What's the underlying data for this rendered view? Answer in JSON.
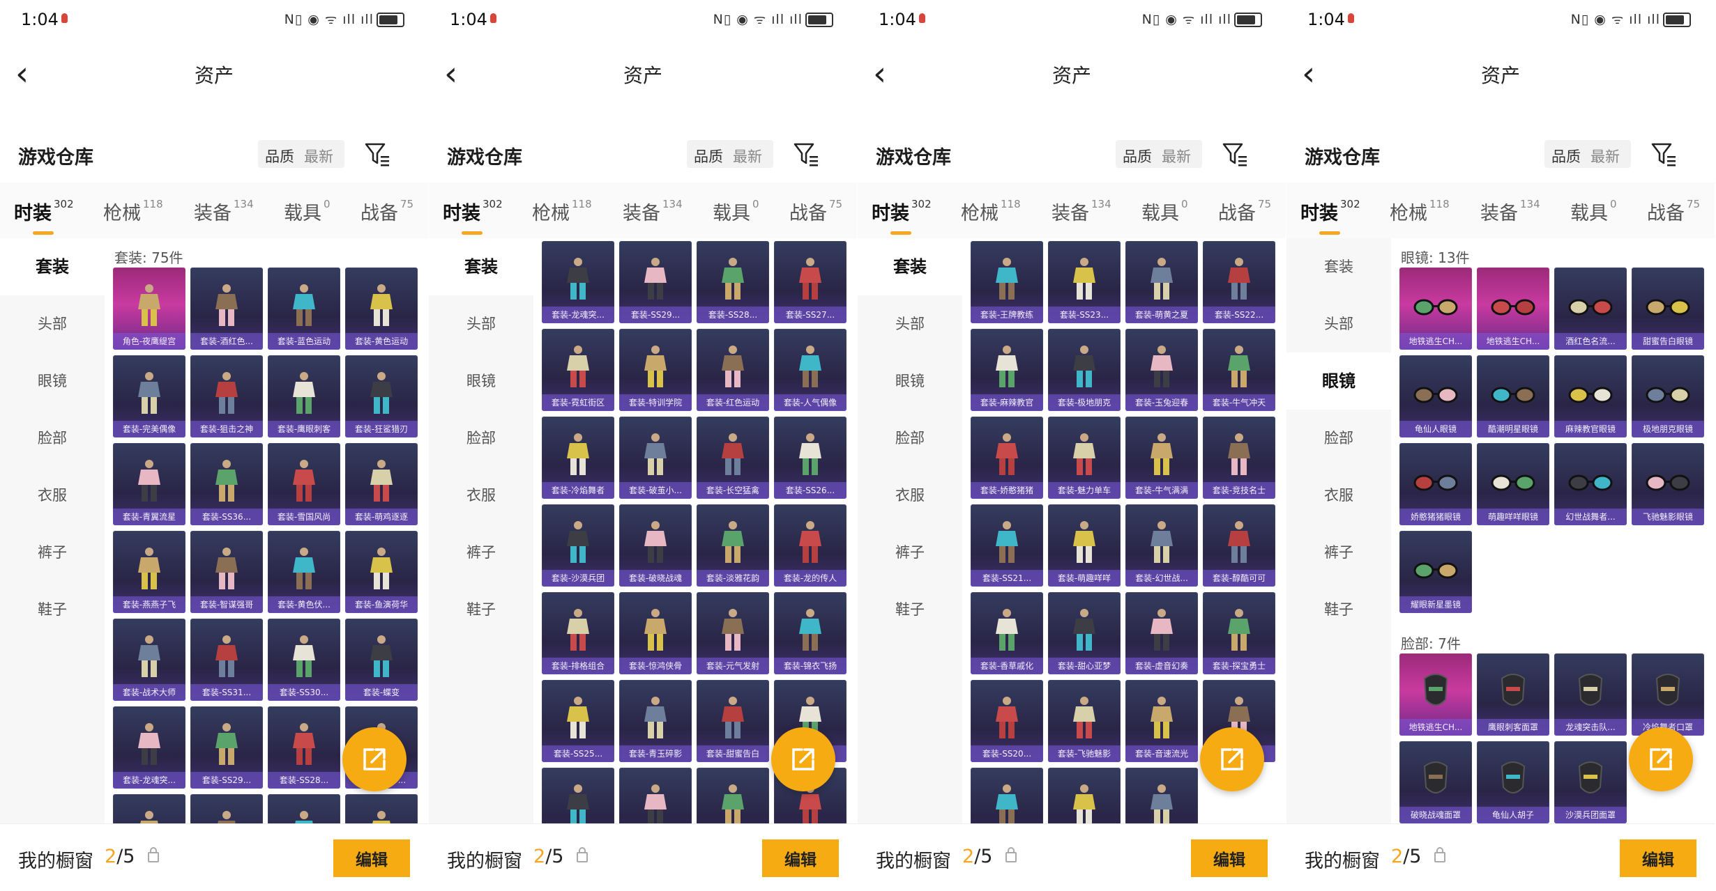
{
  "status_time": "1:04",
  "status_icons": "N▯ ◉ ᯤ ıll ıll",
  "page_title": "资产",
  "warehouse_title": "游戏仓库",
  "sort_quality": "品质",
  "sort_newest": "最新",
  "tabs": [
    {
      "label": "时装",
      "count": "302"
    },
    {
      "label": "枪械",
      "count": "118"
    },
    {
      "label": "装备",
      "count": "134"
    },
    {
      "label": "载具",
      "count": "0"
    },
    {
      "label": "战备",
      "count": "75"
    }
  ],
  "side_items": [
    "套装",
    "头部",
    "眼镜",
    "脸部",
    "衣服",
    "裤子",
    "鞋子"
  ],
  "footer": {
    "label": "我的橱窗",
    "current": "2",
    "total": "/5",
    "edit": "编辑"
  },
  "panels": [
    {
      "active_side": 0,
      "sections": [
        {
          "header": "套装: 75件",
          "items": [
            "角色-夜鹰缇宫",
            "套装-酒红色...",
            "套装-蓝色运动",
            "套装-黄色运动",
            "套装-完美偶像",
            "套装-狙击之神",
            "套装-鹰眼刺客",
            "套装-狂鲨猎刃",
            "套装-青翼流星",
            "套装-SS36...",
            "套装-雪国风尚",
            "套装-萌鸡逐逐",
            "套装-燕燕子飞",
            "套装-智谋强哥",
            "套装-黄色伏...",
            "套装-鱼演荷华",
            "套装-战术大师",
            "套装-SS31...",
            "套装-SS30...",
            "套装-蝶变",
            "套装-龙魂突...",
            "套装-SS29...",
            "套装-SS28...",
            "套装-SS27...",
            "",
            "",
            "",
            ""
          ]
        }
      ]
    },
    {
      "active_side": 0,
      "sections": [
        {
          "header": "",
          "items": [
            "套装-龙魂突...",
            "套装-SS29...",
            "套装-SS28...",
            "套装-SS27...",
            "套装-霓虹街区",
            "套装-特训学院",
            "套装-红色运动",
            "套装-人气偶像",
            "套装-冷焰舞者",
            "套装-破茧小...",
            "套装-长空猛禽",
            "套装-SS26...",
            "套装-沙漠兵团",
            "套装-破晓战魂",
            "套装-淡雅花韵",
            "套装-龙的传人",
            "套装-排格组合",
            "套装-惊鸿侠骨",
            "套装-元气发射",
            "套装-锦衣飞扬",
            "套装-SS25...",
            "套装-青玉碎影",
            "套装-甜蜜告白",
            "套装-SS2...",
            "",
            "",
            "",
            ""
          ]
        }
      ]
    },
    {
      "active_side": 0,
      "sections": [
        {
          "header": "",
          "items": [
            "套装-王牌教练",
            "套装-SS23...",
            "套装-萌黄之夏",
            "套装-SS22...",
            "套装-麻辣教官",
            "套装-极地朋克",
            "套装-玉兔迎春",
            "套装-牛气冲天",
            "套装-娇憨猪猪",
            "套装-魅力单车",
            "套装-牛气满满",
            "套装-竞技名士",
            "套装-SS21...",
            "套装-萌趣咩咩",
            "套装-幻世战...",
            "套装-醇酷可可",
            "套装-香草戚化",
            "套装-甜心亚梦",
            "套装-虚音幻奏",
            "套装-探宝勇士",
            "套装-SS20...",
            "套装-飞驰魅影",
            "套装-音速流光",
            "套装-SS1...",
            "",
            "",
            ""
          ]
        }
      ]
    },
    {
      "active_side": 2,
      "sections": [
        {
          "header": "眼镜: 13件",
          "items": [
            "地铁逃生CH...",
            "地铁逃生CH...",
            "酒红色名流...",
            "甜蜜告白眼镜",
            "龟仙人眼镜",
            "酷潮明星眼镜",
            "麻辣教官眼镜",
            "极地朋克眼镜",
            "娇憨猪猪眼镜",
            "萌趣咩咩眼镜",
            "幻世战舞者...",
            "飞驰魅影眼镜",
            "耀眼新星墨镜"
          ]
        },
        {
          "header": "脸部: 7件",
          "items": [
            "地铁逃生CH...",
            "鹰眼刺客面罩",
            "龙魂突击队...",
            "冷焰舞者口罩",
            "破晓战魂面罩",
            "龟仙人胡子",
            "沙漠兵团面罩"
          ]
        }
      ]
    }
  ]
}
